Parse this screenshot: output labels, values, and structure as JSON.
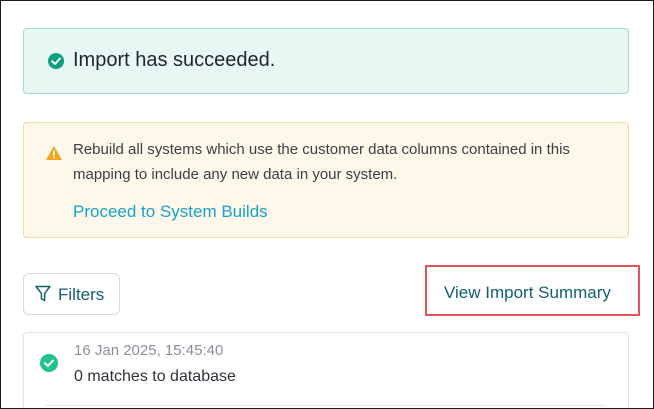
{
  "success_banner": {
    "message": "Import has succeeded.",
    "icon": "check-circle-icon",
    "status_color": "#0e9f7e"
  },
  "warning_panel": {
    "icon": "warning-triangle-icon",
    "text": "Rebuild all systems which use the customer data columns contained in this mapping to include any new data in your system.",
    "link_label": "Proceed to System Builds",
    "link_color": "#1aa0c8"
  },
  "toolbar": {
    "filters_label": "Filters",
    "filters_icon": "funnel-icon",
    "view_summary_label": "View Import Summary",
    "highlight_color": "#e4525a"
  },
  "history": {
    "items": [
      {
        "timestamp": "16 Jan 2025, 15:45:40",
        "summary": "0 matches to database",
        "status_icon": "success-dot-icon"
      }
    ]
  }
}
